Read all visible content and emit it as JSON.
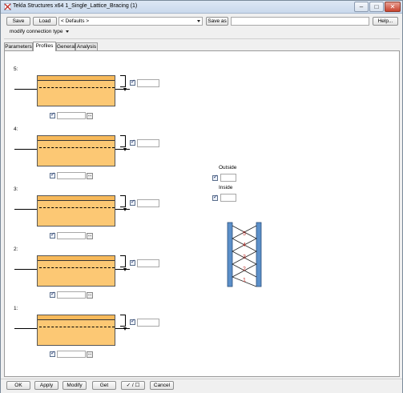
{
  "window": {
    "title": "Tekla Structures x64  1_Single_Lattice_Bracing (1)",
    "controls": {
      "minimize": "–",
      "maximize": "□",
      "close": "✕"
    }
  },
  "toolbar": {
    "save_label": "Save",
    "load_label": "Load",
    "preset_value": "< Defaults >",
    "save_as_label": "Save as",
    "save_as_value": "",
    "help_label": "Help..."
  },
  "mode": {
    "value": "modify connection type"
  },
  "tabs": [
    {
      "label": "Parameters",
      "active": false
    },
    {
      "label": "Profiles",
      "active": true
    },
    {
      "label": "General",
      "active": false
    },
    {
      "label": "Analysis",
      "active": false
    }
  ],
  "profiles": [
    {
      "label": "5:",
      "offset_value": "",
      "profile_value": "",
      "browse_label": "..."
    },
    {
      "label": "4:",
      "offset_value": "",
      "profile_value": "",
      "browse_label": "..."
    },
    {
      "label": "3:",
      "offset_value": "",
      "profile_value": "",
      "browse_label": "..."
    },
    {
      "label": "2:",
      "offset_value": "",
      "profile_value": "",
      "browse_label": "..."
    },
    {
      "label": "1:",
      "offset_value": "",
      "profile_value": "",
      "browse_label": "..."
    }
  ],
  "placement": {
    "outside_label": "Outside",
    "outside_value": "",
    "inside_label": "Inside",
    "inside_value": ""
  },
  "diagram": {
    "member_numbers": [
      "5",
      "4",
      "3",
      "2",
      "1"
    ],
    "colors": {
      "chord": "#5b8fc9",
      "lattice": "#222222",
      "numbers": "#c0302a"
    }
  },
  "bottom": {
    "ok_label": "OK",
    "apply_label": "Apply",
    "modify_label": "Modify",
    "get_label": "Get",
    "toggle_label": "✓ / ☐",
    "cancel_label": "Cancel"
  },
  "colors": {
    "profile_fill": "#fcc874",
    "profile_band": "#f7b95a",
    "titlebar": "#c9d9ec"
  }
}
